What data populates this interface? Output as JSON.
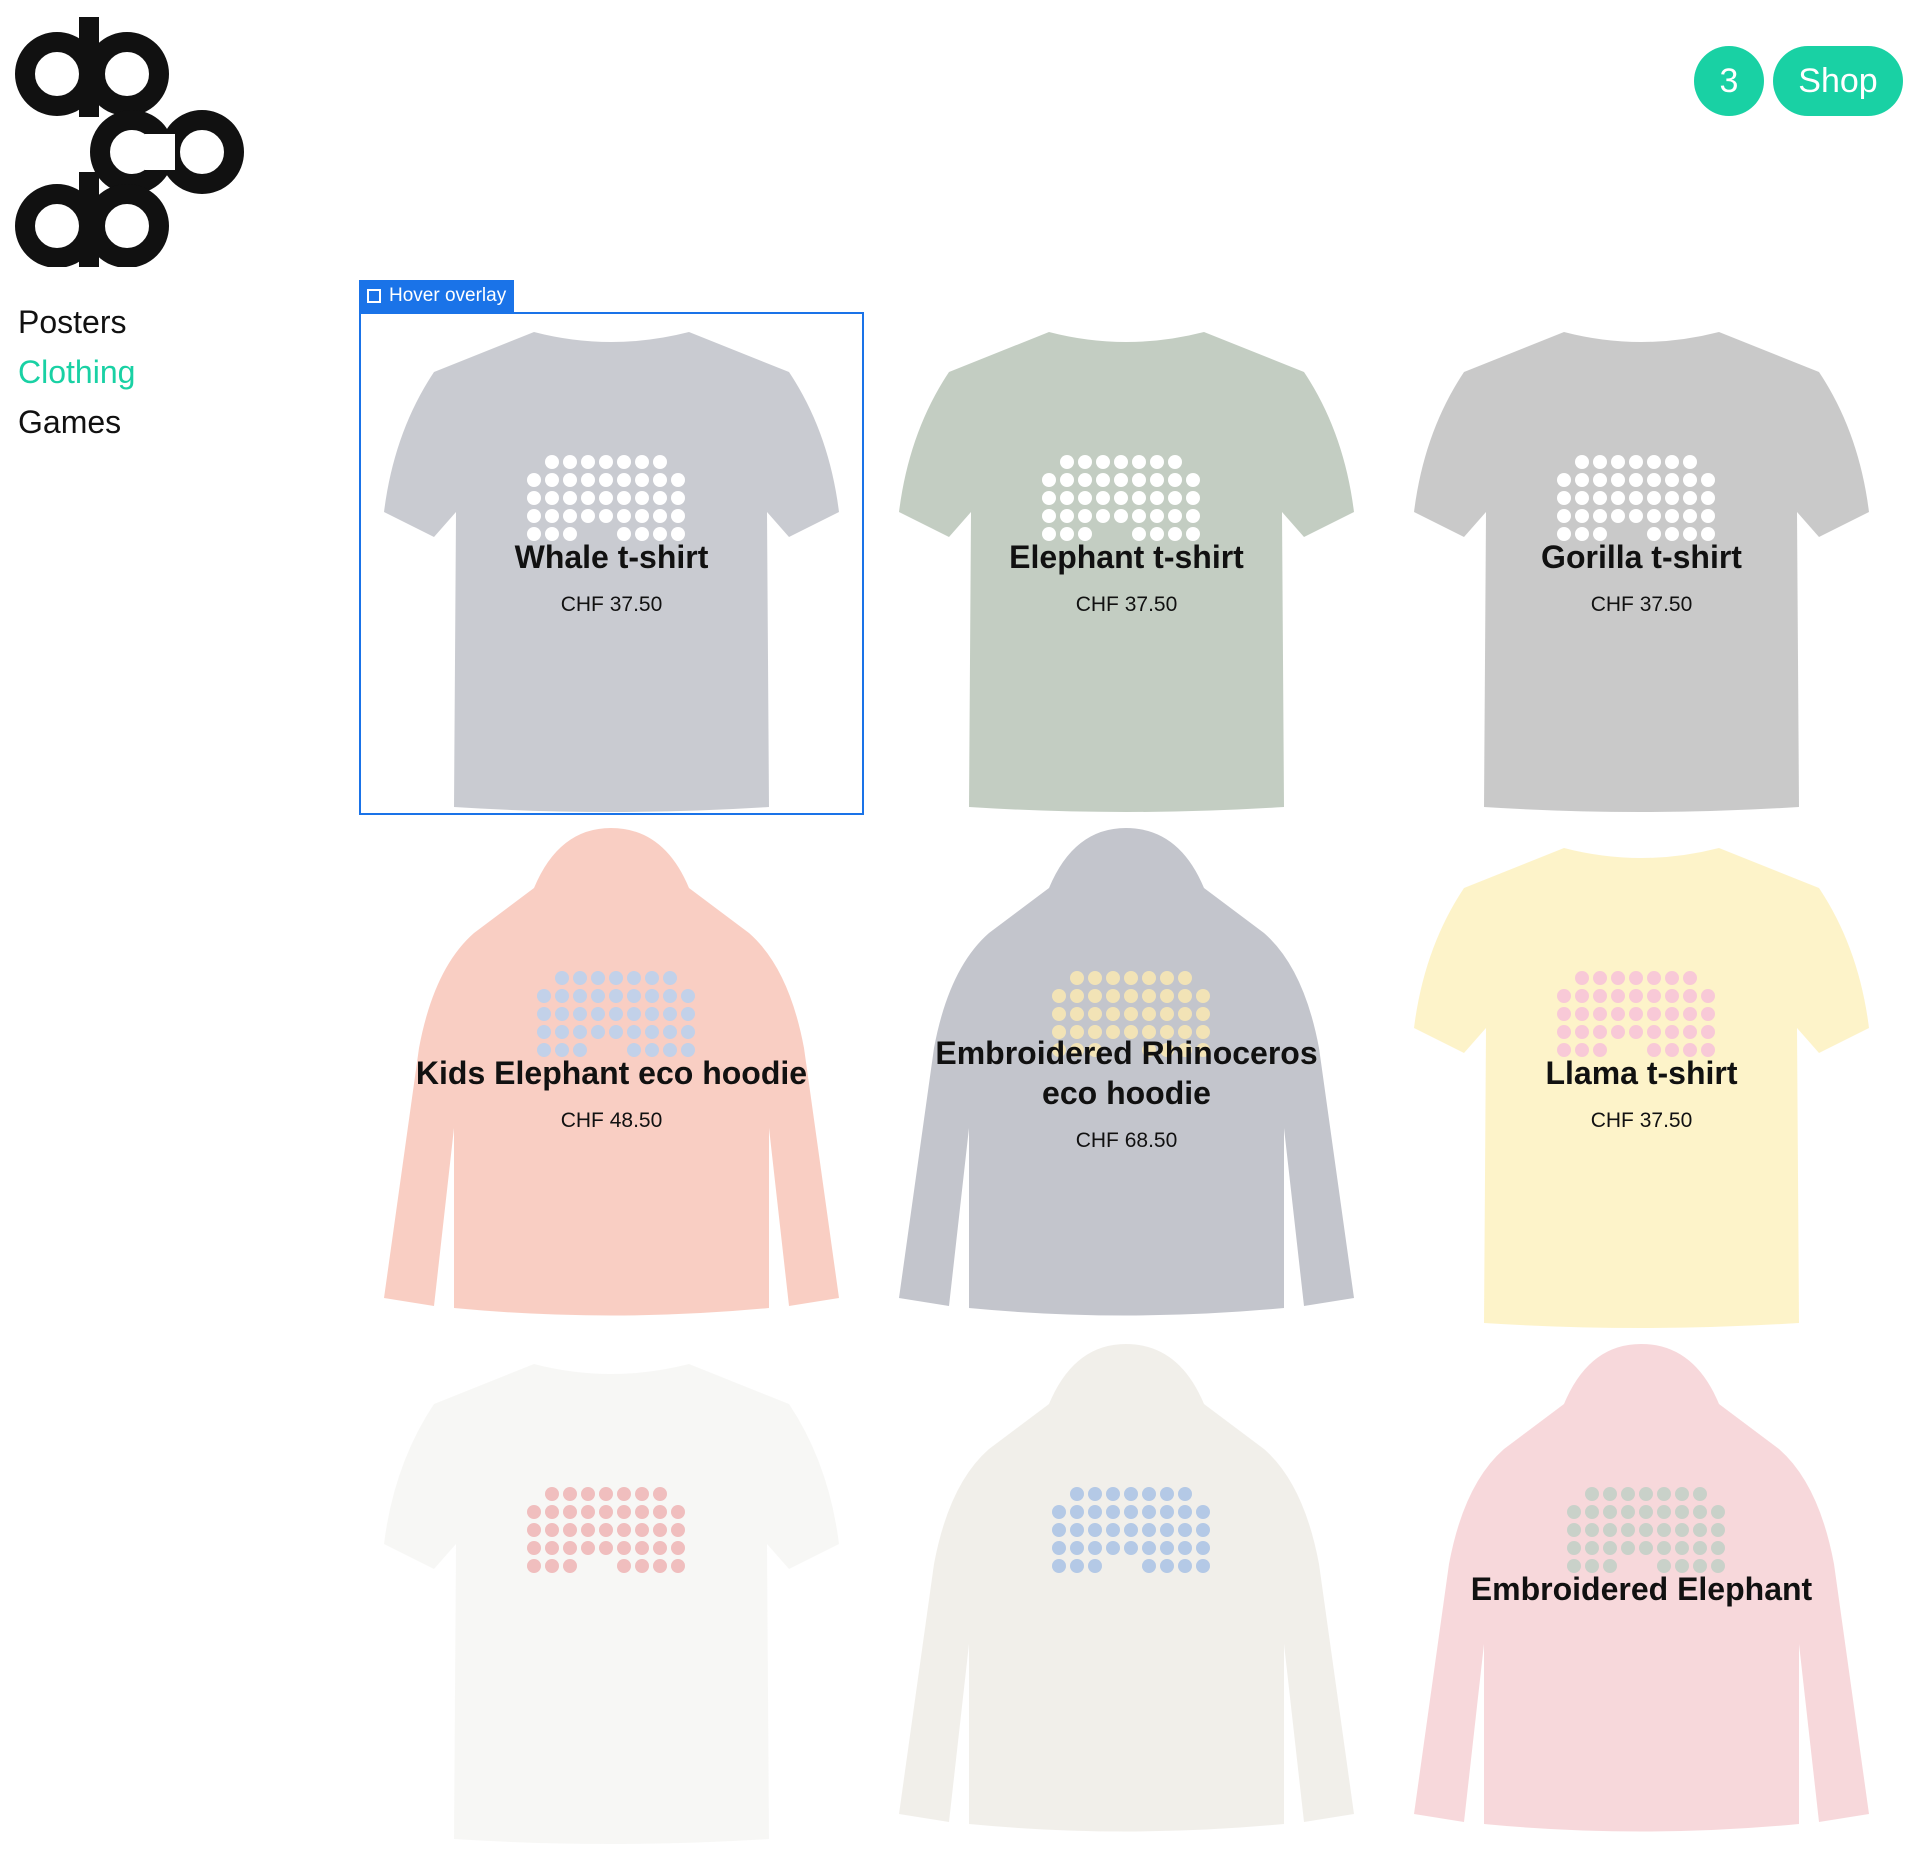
{
  "header": {
    "cart_count": "3",
    "shop_label": "Shop",
    "accent_color": "#19d1a4"
  },
  "logo": {
    "lines": [
      "do",
      "co",
      "do"
    ]
  },
  "nav": {
    "items": [
      {
        "label": "Posters",
        "active": false
      },
      {
        "label": "Clothing",
        "active": true
      },
      {
        "label": "Games",
        "active": false
      }
    ]
  },
  "overlay": {
    "label": "Hover overlay"
  },
  "products": [
    {
      "name": "Whale t-shirt",
      "price": "CHF 37.50",
      "kind": "tshirt",
      "color": "#8a8e9a",
      "print": "#ffffff",
      "animal": "whale-icon"
    },
    {
      "name": "Elephant t-shirt",
      "price": "CHF 37.50",
      "kind": "tshirt",
      "color": "#7b9279",
      "print": "#ffffff",
      "animal": "elephant-icon"
    },
    {
      "name": "Gorilla t-shirt",
      "price": "CHF 37.50",
      "kind": "tshirt",
      "color": "#8a8a8a",
      "print": "#ffffff",
      "animal": "gorilla-icon"
    },
    {
      "name": "Kids Elephant eco hoodie",
      "price": "CHF 48.50",
      "kind": "hoodie",
      "color": "#f2957c",
      "print": "#7a9ad0",
      "animal": "elephant-icon"
    },
    {
      "name": "Embroidered Rhinoceros eco hoodie",
      "price": "CHF 68.50",
      "kind": "hoodie",
      "color": "#7b7f90",
      "print": "#e4c35e",
      "animal": "rhinoceros-icon"
    },
    {
      "name": "Llama t-shirt",
      "price": "CHF 37.50",
      "kind": "tshirt",
      "color": "#fbe58a",
      "print": "#f08aa8",
      "animal": "llama-icon"
    },
    {
      "name": "",
      "price": "",
      "kind": "tshirt",
      "color": "#eeeeea",
      "print": "#e07070",
      "animal": "crab-icon"
    },
    {
      "name": "",
      "price": "",
      "kind": "hoodie",
      "color": "#e2dcd2",
      "print": "#5a88c8",
      "animal": "whale-icon"
    },
    {
      "name": "Embroidered Elephant",
      "price": "",
      "kind": "hoodie",
      "color": "#efaab0",
      "print": "#8a9a8a",
      "animal": "elephant-icon"
    }
  ]
}
